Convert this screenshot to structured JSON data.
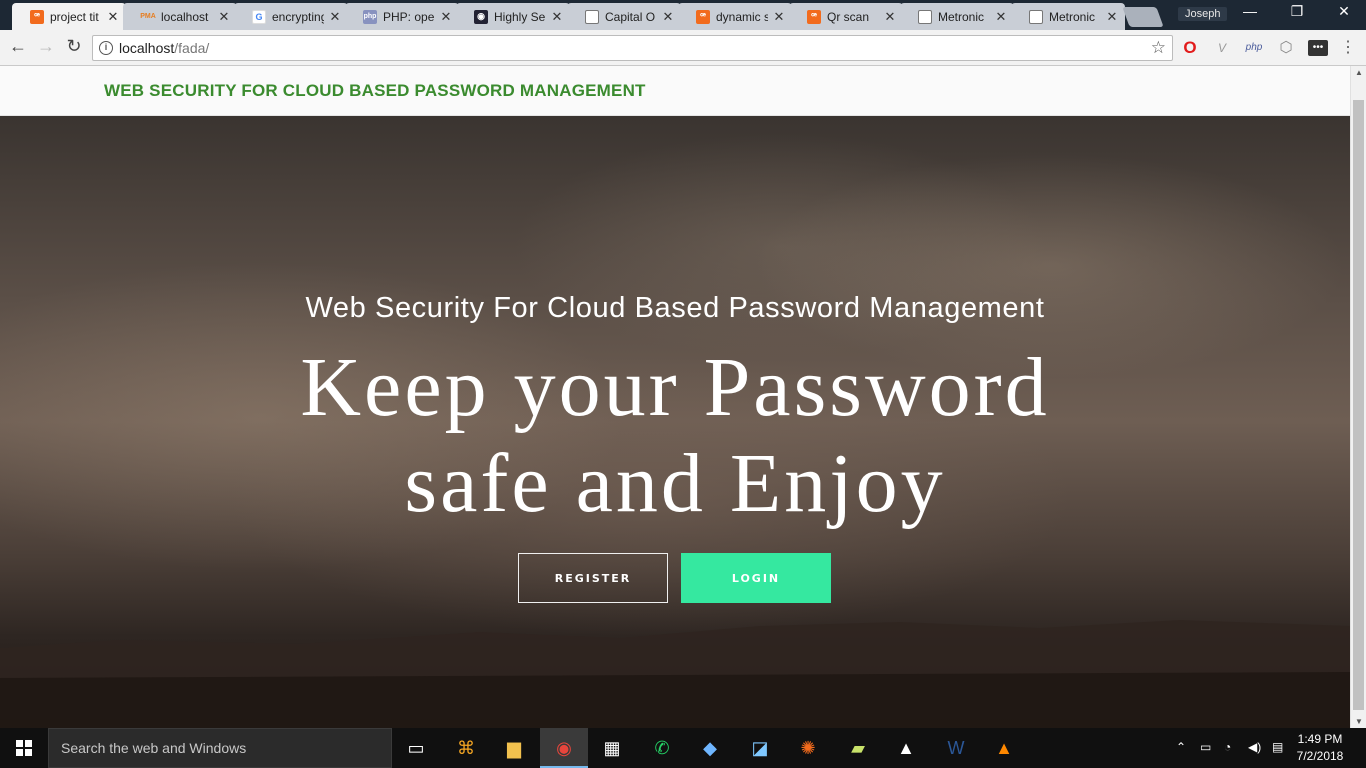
{
  "browser": {
    "tabs": [
      {
        "label": "project tit",
        "favicon": "xampp-icon",
        "active": true
      },
      {
        "label": "localhost",
        "favicon": "phpmyadmin-icon"
      },
      {
        "label": "encrypting",
        "favicon": "google-icon"
      },
      {
        "label": "PHP: oper",
        "favicon": "php-icon"
      },
      {
        "label": "Highly Se",
        "favicon": "site-icon"
      },
      {
        "label": "Capital O",
        "favicon": "document-icon"
      },
      {
        "label": "dynamic s",
        "favicon": "xampp-icon"
      },
      {
        "label": "Qr scan",
        "favicon": "xampp-icon"
      },
      {
        "label": "Metronic",
        "favicon": "document-icon"
      },
      {
        "label": "Metronic",
        "favicon": "document-icon"
      }
    ],
    "profile_name": "Joseph",
    "url_host": "localhost",
    "url_path": "/fada/"
  },
  "site": {
    "brand": "WEB SECURITY FOR CLOUD BASED PASSWORD MANAGEMENT",
    "hero_subtitle": "Web Security For Cloud Based Password Management",
    "hero_line1": "Keep your Password",
    "hero_line2": "safe and Enjoy",
    "register_label": "REGISTER",
    "login_label": "LOGIN",
    "colors": {
      "brand": "#3b8b2f",
      "login_bg": "#35e8a0"
    }
  },
  "taskbar": {
    "search_placeholder": "Search the web and Windows",
    "time": "1:49 PM",
    "date": "7/2/2018"
  }
}
